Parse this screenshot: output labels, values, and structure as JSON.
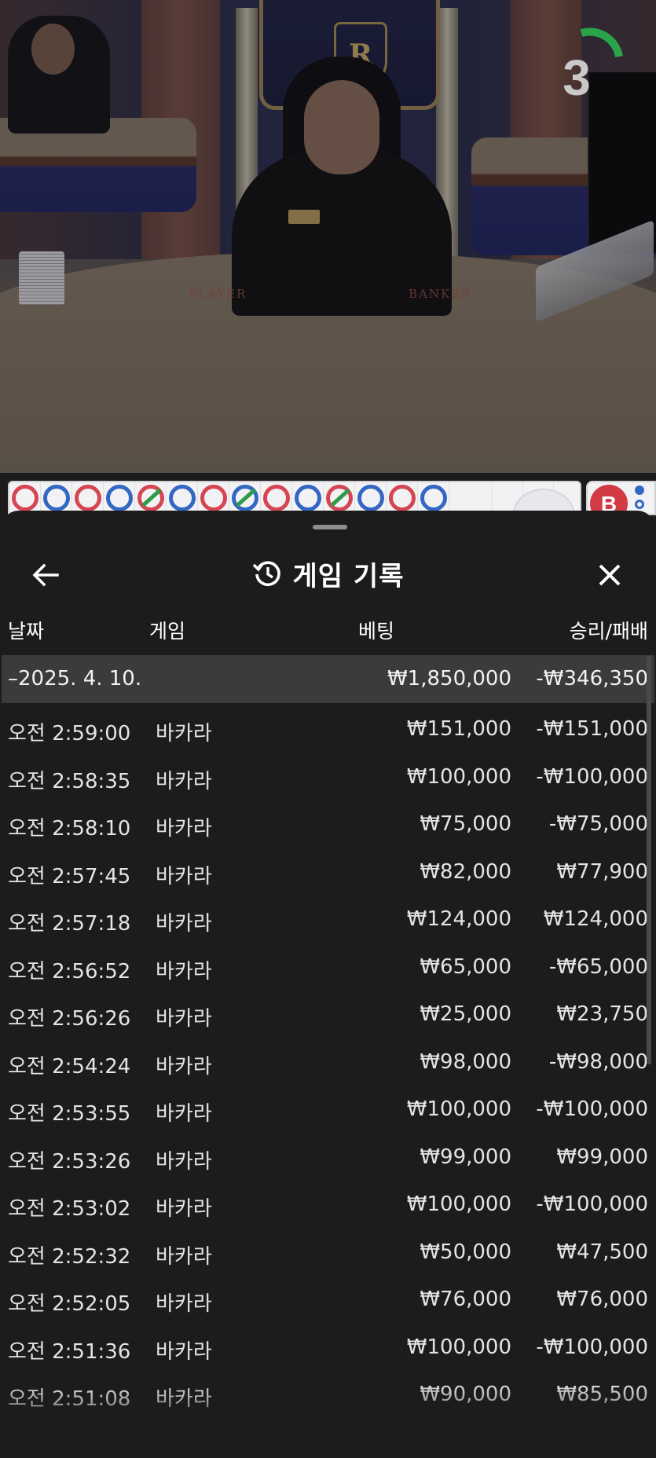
{
  "video": {
    "countdown": "3",
    "table_print_left": "PLAYER",
    "table_print_right": "BANKER",
    "crest_letter": "R"
  },
  "roadmap": {
    "cells": [
      {
        "result": "banker",
        "tie": false
      },
      {
        "result": "player",
        "tie": false
      },
      {
        "result": "banker",
        "tie": false
      },
      {
        "result": "player",
        "tie": false
      },
      {
        "result": "banker",
        "tie": true
      },
      {
        "result": "player",
        "tie": false
      },
      {
        "result": "banker",
        "tie": false
      },
      {
        "result": "player",
        "tie": true
      },
      {
        "result": "banker",
        "tie": false
      },
      {
        "result": "player",
        "tie": false
      },
      {
        "result": "banker",
        "tie": true
      },
      {
        "result": "player",
        "tie": false
      },
      {
        "result": "banker",
        "tie": false
      },
      {
        "result": "player",
        "tie": false
      }
    ],
    "side_badge": "B",
    "colors": {
      "banker": "#d64552",
      "player": "#3466c3",
      "tie": "#2f9a48"
    }
  },
  "history": {
    "title": "게임 기록",
    "back_icon": "arrow-left-icon",
    "title_icon": "history-clock-icon",
    "close_icon": "close-icon",
    "columns": {
      "date": "날짜",
      "game": "게임",
      "bet": "베팅",
      "result": "승리/패배"
    },
    "day": {
      "label": "–2025. 4. 10.",
      "bet_total": "₩1,850,000",
      "result_total": "-₩346,350"
    },
    "rows": [
      {
        "time": "오전 2:59:00",
        "game": "바카라",
        "bet": "₩151,000",
        "result": "-₩151,000"
      },
      {
        "time": "오전 2:58:35",
        "game": "바카라",
        "bet": "₩100,000",
        "result": "-₩100,000"
      },
      {
        "time": "오전 2:58:10",
        "game": "바카라",
        "bet": "₩75,000",
        "result": "-₩75,000"
      },
      {
        "time": "오전 2:57:45",
        "game": "바카라",
        "bet": "₩82,000",
        "result": "₩77,900"
      },
      {
        "time": "오전 2:57:18",
        "game": "바카라",
        "bet": "₩124,000",
        "result": "₩124,000"
      },
      {
        "time": "오전 2:56:52",
        "game": "바카라",
        "bet": "₩65,000",
        "result": "-₩65,000"
      },
      {
        "time": "오전 2:56:26",
        "game": "바카라",
        "bet": "₩25,000",
        "result": "₩23,750"
      },
      {
        "time": "오전 2:54:24",
        "game": "바카라",
        "bet": "₩98,000",
        "result": "-₩98,000"
      },
      {
        "time": "오전 2:53:55",
        "game": "바카라",
        "bet": "₩100,000",
        "result": "-₩100,000"
      },
      {
        "time": "오전 2:53:26",
        "game": "바카라",
        "bet": "₩99,000",
        "result": "₩99,000"
      },
      {
        "time": "오전 2:53:02",
        "game": "바카라",
        "bet": "₩100,000",
        "result": "-₩100,000"
      },
      {
        "time": "오전 2:52:32",
        "game": "바카라",
        "bet": "₩50,000",
        "result": "₩47,500"
      },
      {
        "time": "오전 2:52:05",
        "game": "바카라",
        "bet": "₩76,000",
        "result": "₩76,000"
      },
      {
        "time": "오전 2:51:36",
        "game": "바카라",
        "bet": "₩100,000",
        "result": "-₩100,000"
      },
      {
        "time": "오전 2:51:08",
        "game": "바카라",
        "bet": "₩90,000",
        "result": "₩85,500"
      }
    ]
  }
}
